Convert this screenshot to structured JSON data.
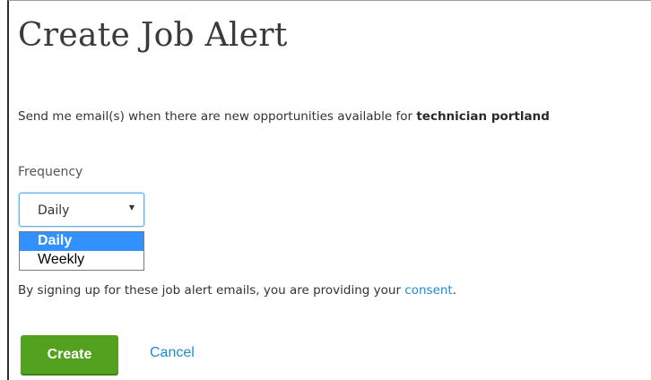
{
  "dialog": {
    "title": "Create Job Alert",
    "description_prefix": "Send me email(s) when there are new opportunities available for ",
    "description_keyword": "technician portland"
  },
  "frequency": {
    "label": "Frequency",
    "selected_value": "Daily",
    "options": [
      "Daily",
      "Weekly"
    ]
  },
  "consent": {
    "text_before": "By signing up for these job alert emails, you are providing your ",
    "link_text": "consent",
    "text_after": "."
  },
  "actions": {
    "create_label": "Create",
    "cancel_label": "Cancel"
  },
  "colors": {
    "primary_button": "#53a21f",
    "link": "#1a8ccf",
    "option_highlight": "#3390ff"
  }
}
